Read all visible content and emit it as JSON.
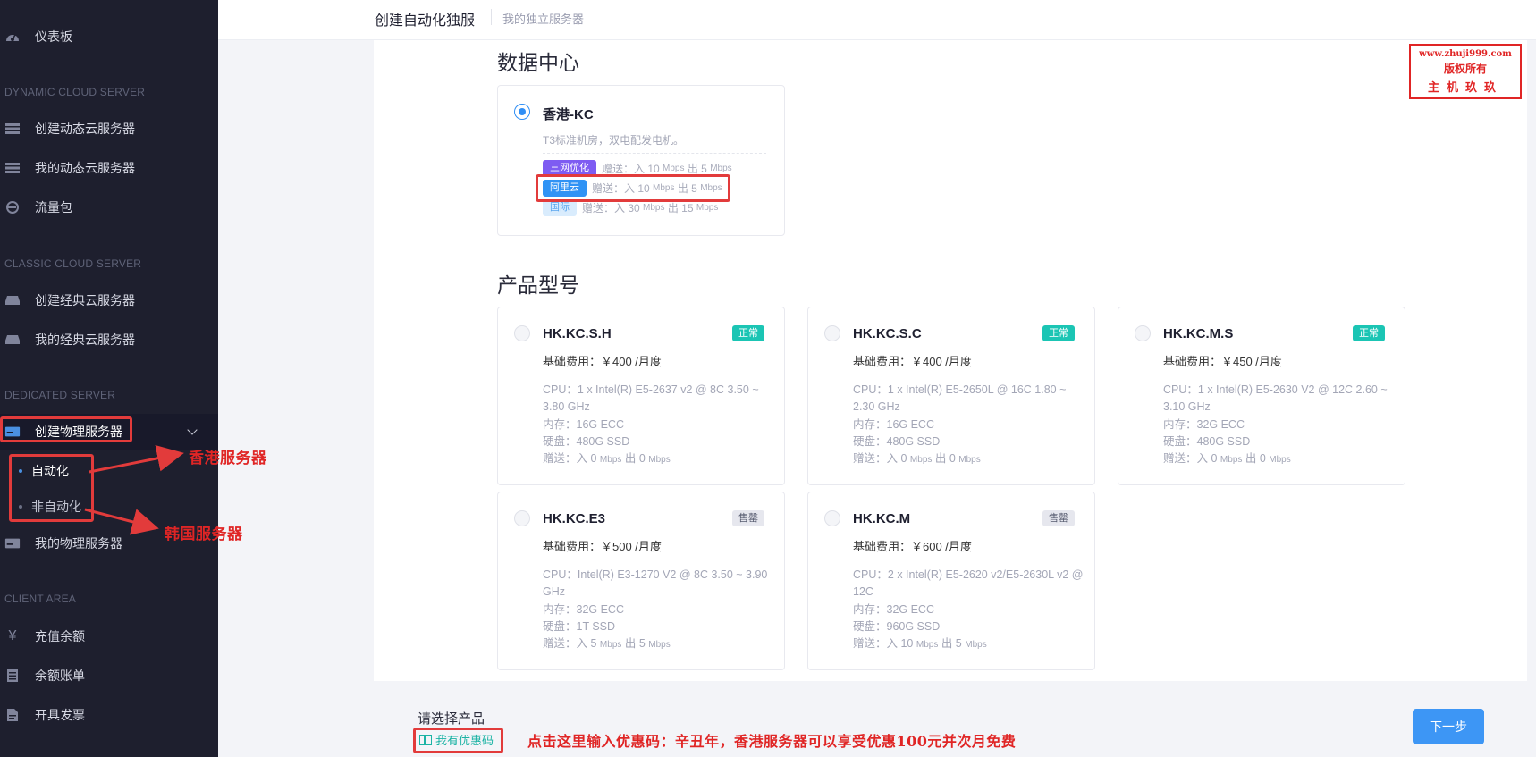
{
  "sidebar": {
    "dashboard": "仪表板",
    "sections": {
      "dynamic": "DYNAMIC CLOUD SERVER",
      "classic": "CLASSIC CLOUD SERVER",
      "dedicated": "DEDICATED SERVER",
      "client": "CLIENT AREA"
    },
    "items": {
      "create_dynamic": "创建动态云服务器",
      "my_dynamic": "我的动态云服务器",
      "traffic": "流量包",
      "create_classic": "创建经典云服务器",
      "my_classic": "我的经典云服务器",
      "create_physical": "创建物理服务器",
      "auto": "自动化",
      "non_auto": "非自动化",
      "my_physical": "我的物理服务器",
      "recharge": "充值余额",
      "bill": "余额账单",
      "invoice": "开具发票"
    }
  },
  "topbar": {
    "title": "创建自动化独服",
    "breadcrumb": "我的独立服务器"
  },
  "datacenter": {
    "heading": "数据中心",
    "name": "香港-KC",
    "desc": "T3标准机房，双电配发电机。",
    "networks": [
      {
        "tag": "三网优化",
        "gift": "赠送：入 10",
        "unit1": "Mbps",
        "out": "出 5",
        "unit2": "Mbps"
      },
      {
        "tag": "阿里云",
        "gift": "赠送：入 10",
        "unit1": "Mbps",
        "out": "出 5",
        "unit2": "Mbps"
      },
      {
        "tag": "国际",
        "gift": "赠送：入 30",
        "unit1": "Mbps",
        "out": "出 15",
        "unit2": "Mbps"
      }
    ]
  },
  "products": {
    "heading": "产品型号",
    "items": [
      {
        "name": "HK.KC.S.H",
        "status": "正常",
        "price": "基础费用：￥400 /月度",
        "cpu": "CPU：1 x Intel(R) E5-2637 v2 @ 8C 3.50 ~ 3.80 GHz",
        "ram": "内存：16G ECC",
        "disk": "硬盘：480G SSD",
        "gift": "赠送：入 0",
        "gift_unit1": "Mbps",
        "gift_out": "出 0",
        "gift_unit2": "Mbps"
      },
      {
        "name": "HK.KC.S.C",
        "status": "正常",
        "price": "基础费用：￥400 /月度",
        "cpu": "CPU：1 x Intel(R) E5-2650L @ 16C 1.80 ~ 2.30 GHz",
        "ram": "内存：16G ECC",
        "disk": "硬盘：480G SSD",
        "gift": "赠送：入 0",
        "gift_unit1": "Mbps",
        "gift_out": "出 0",
        "gift_unit2": "Mbps"
      },
      {
        "name": "HK.KC.M.S",
        "status": "正常",
        "price": "基础费用：￥450 /月度",
        "cpu": "CPU：1 x Intel(R) E5-2630 V2 @ 12C 2.60 ~ 3.10 GHz",
        "ram": "内存：32G ECC",
        "disk": "硬盘：480G SSD",
        "gift": "赠送：入 0",
        "gift_unit1": "Mbps",
        "gift_out": "出 0",
        "gift_unit2": "Mbps"
      },
      {
        "name": "HK.KC.E3",
        "status": "售罄",
        "price": "基础费用：￥500 /月度",
        "cpu": "CPU：Intel(R) E3-1270 V2 @ 8C 3.50 ~ 3.90 GHz",
        "ram": "内存：32G ECC",
        "disk": "硬盘：1T SSD",
        "gift": "赠送：入 5",
        "gift_unit1": "Mbps",
        "gift_out": "出 5",
        "gift_unit2": "Mbps"
      },
      {
        "name": "HK.KC.M",
        "status": "售罄",
        "price": "基础费用：￥600 /月度",
        "cpu": "CPU：2 x Intel(R) E5-2620 v2/E5-2630L v2 @ 12C",
        "ram": "内存：32G ECC",
        "disk": "硬盘：960G SSD",
        "gift": "赠送：入 10",
        "gift_unit1": "Mbps",
        "gift_out": "出 5",
        "gift_unit2": "Mbps"
      }
    ]
  },
  "footer": {
    "prompt": "请选择产品",
    "coupon": "我有优惠码",
    "next": "下一步"
  },
  "annotations": {
    "hk": "香港服务器",
    "kr": "韩国服务器",
    "coupon_note": "点击这里输入优惠码：辛丑年，香港服务器可以享受优惠100元并次月免费"
  },
  "watermark": {
    "site": "www.zhuji999.com",
    "rights": "版权所有",
    "brand": "主机玖玖"
  },
  "colors": {
    "sidebar_bg": "#1e1f2e",
    "accent": "#3d96f5",
    "ok": "#1bc5b4",
    "annotation_red": "#e02525"
  }
}
